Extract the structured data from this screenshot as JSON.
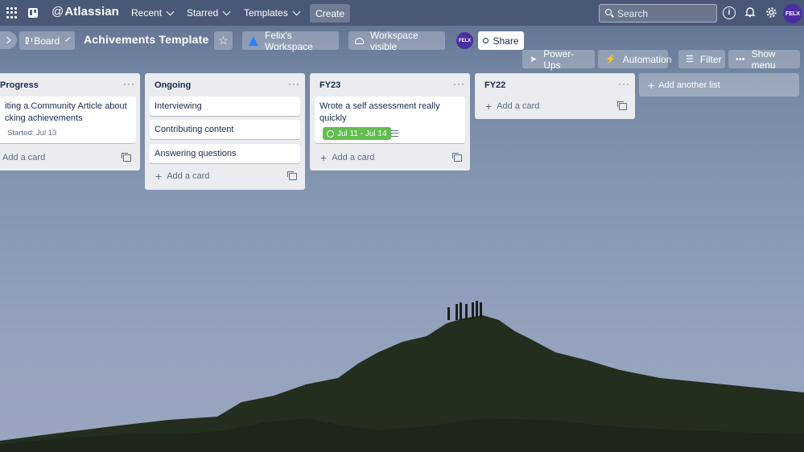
{
  "topnav": {
    "brand_at": "@",
    "brand": "Atlassian",
    "recent": "Recent",
    "starred": "Starred",
    "templates": "Templates",
    "create": "Create",
    "search_placeholder": "Search",
    "info_icon": "i",
    "avatar": "FELX"
  },
  "board": {
    "view": "Board",
    "title": "Achivements Template",
    "workspace": "Felix's Workspace",
    "visibility": "Workspace visible",
    "share": "Share",
    "member_avatar": "FELX",
    "power_ups": "Power-Ups",
    "automation": "Automation",
    "filter": "Filter",
    "show_menu": "Show menu"
  },
  "lists": [
    {
      "title": "Progress",
      "cards": [
        {
          "text": "iting a Community Article about cking achievements",
          "meta": "Started: Jul 13"
        }
      ],
      "add_card": "Add a card"
    },
    {
      "title": "Ongoing",
      "cards": [
        {
          "text": "Interviewing"
        },
        {
          "text": "Contributing content"
        },
        {
          "text": "Answering questions"
        }
      ],
      "add_card": "Add a card"
    },
    {
      "title": "FY23",
      "cards": [
        {
          "text": "Wrote a self assessment really quickly",
          "date": "Jul 11 - Jul 14"
        }
      ],
      "add_card": "Add a card"
    },
    {
      "title": "FY22",
      "cards": [],
      "add_card": "Add a card"
    }
  ],
  "add_another_list": "Add another list",
  "colors": {
    "date_badge": "#61bd4f",
    "avatar": "#4b2fa0",
    "list_bg": "#ebecf0"
  }
}
